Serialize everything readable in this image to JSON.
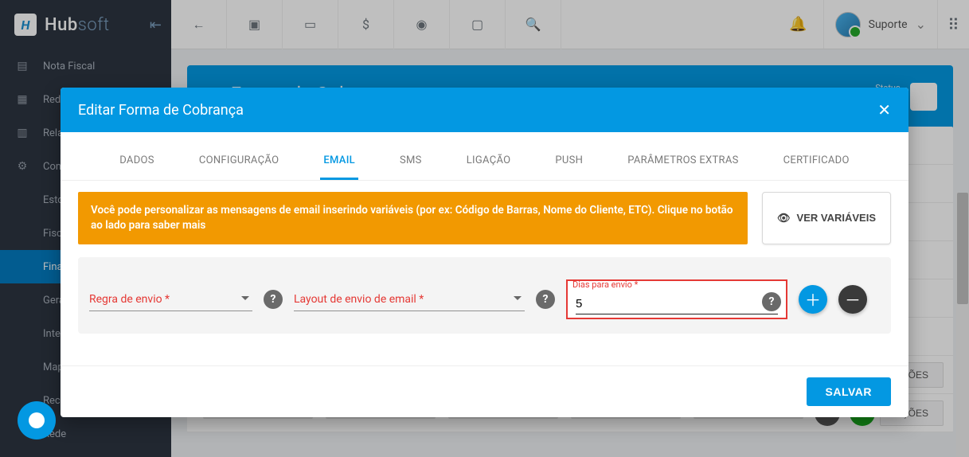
{
  "brand": {
    "name": "Hubsoft",
    "prefix": "Hub",
    "suffix": "soft"
  },
  "sidebar": {
    "items": [
      {
        "label": "Nota Fiscal"
      },
      {
        "label": "Rede"
      },
      {
        "label": "Relatórios"
      },
      {
        "label": "Configurações"
      },
      {
        "label": "Estoque"
      },
      {
        "label": "Fiscal"
      },
      {
        "label": "Financeiro"
      },
      {
        "label": "Geral"
      },
      {
        "label": "Integrações"
      },
      {
        "label": "Mapeamento"
      },
      {
        "label": "Recursos Humanos"
      },
      {
        "label": "Rede"
      }
    ]
  },
  "topbar": {
    "user_role": "Suporte"
  },
  "page": {
    "title": "Forma de Cobrança",
    "status_label": "Status",
    "action_button": "AÇÕES"
  },
  "modal": {
    "title": "Editar Forma de Cobrança",
    "tabs": [
      "DADOS",
      "CONFIGURAÇÃO",
      "EMAIL",
      "SMS",
      "LIGAÇÃO",
      "PUSH",
      "PARÂMETROS EXTRAS",
      "CERTIFICADO"
    ],
    "active_tab": "EMAIL",
    "hint": "Você pode personalizar as mensagens de email inserindo variáveis (por ex: Código de Barras, Nome do Cliente, ETC). Clique no botão ao lado para saber mais",
    "var_button": "VER VARIÁVEIS",
    "fields": {
      "regra": "Regra de envio *",
      "layout": "Layout de envio de email *",
      "dias_label": "Dias para envio *",
      "dias_value": "5"
    },
    "save": "SALVAR"
  }
}
